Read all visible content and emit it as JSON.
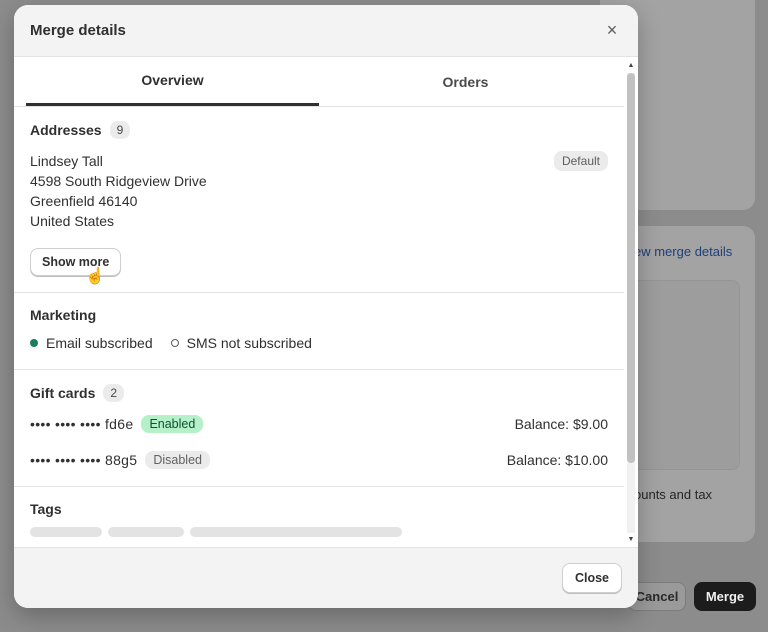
{
  "background": {
    "link_text": "ew merge details",
    "note_text": "ounts and tax",
    "cancel_label": "Cancel",
    "merge_label": "Merge"
  },
  "modal": {
    "title": "Merge details",
    "close_icon": "×",
    "tabs": [
      {
        "label": "Overview",
        "active": true
      },
      {
        "label": "Orders",
        "active": false
      }
    ],
    "addresses": {
      "title": "Addresses",
      "count": "9",
      "lines": [
        "Lindsey Tall",
        "4598 South Ridgeview Drive",
        "Greenfield 46140",
        "United States"
      ],
      "default_badge": "Default",
      "show_more_label": "Show more"
    },
    "marketing": {
      "title": "Marketing",
      "email_status": "Email subscribed",
      "sms_status": "SMS not subscribed",
      "email_dot_color": "#1a7f5a"
    },
    "gift_cards": {
      "title": "Gift cards",
      "count": "2",
      "cards": [
        {
          "code": "•••• •••• •••• fd6e",
          "status": "Enabled",
          "balance": "Balance: $9.00"
        },
        {
          "code": "•••• •••• •••• 88g5",
          "status": "Disabled",
          "balance": "Balance: $10.00"
        }
      ]
    },
    "tags": {
      "title": "Tags"
    },
    "footer": {
      "close_label": "Close"
    }
  }
}
